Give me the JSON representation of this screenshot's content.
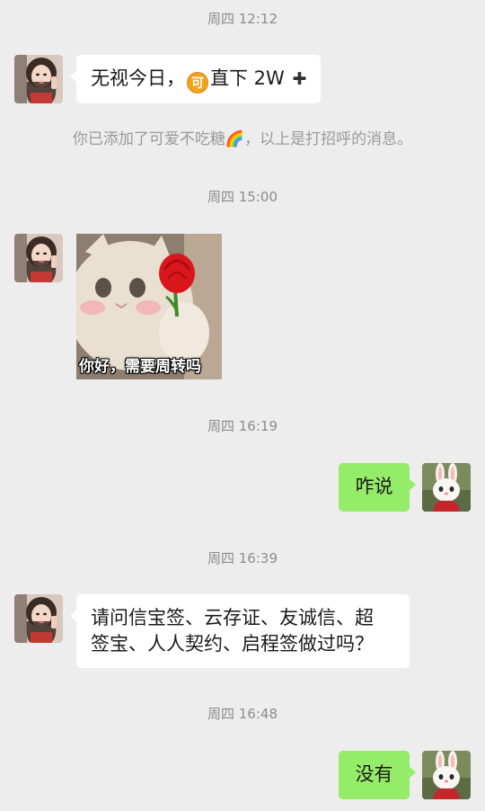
{
  "timestamps": [
    "周四 12:12",
    "周四 15:00",
    "周四 16:19",
    "周四 16:39",
    "周四 16:48"
  ],
  "messages": {
    "m1": {
      "before": "无视今日，",
      "coin": "可",
      "after": "直下 2W",
      "plus": "✚"
    },
    "system": {
      "before": "你已添加了可爱不吃糖",
      "emoji": "🌈",
      "after": "，以上是打招呼的消息。"
    },
    "sticker": {
      "caption": "你好，需要周转吗"
    },
    "m3": {
      "text": "咋说"
    },
    "m4": {
      "line1": "请问信宝签、云存证、友诚信、超",
      "line2": "签宝、人人契约、启程签做过吗？"
    },
    "m5": {
      "text": "没有"
    }
  },
  "colors": {
    "background": "#ededed",
    "bubble_incoming": "#ffffff",
    "bubble_outgoing": "#95ec69",
    "timestamp": "#8c8c8c"
  },
  "icons": [
    "contact-avatar",
    "self-avatar-rabbit",
    "coin-icon",
    "plus-icon",
    "rainbow-emoji"
  ]
}
